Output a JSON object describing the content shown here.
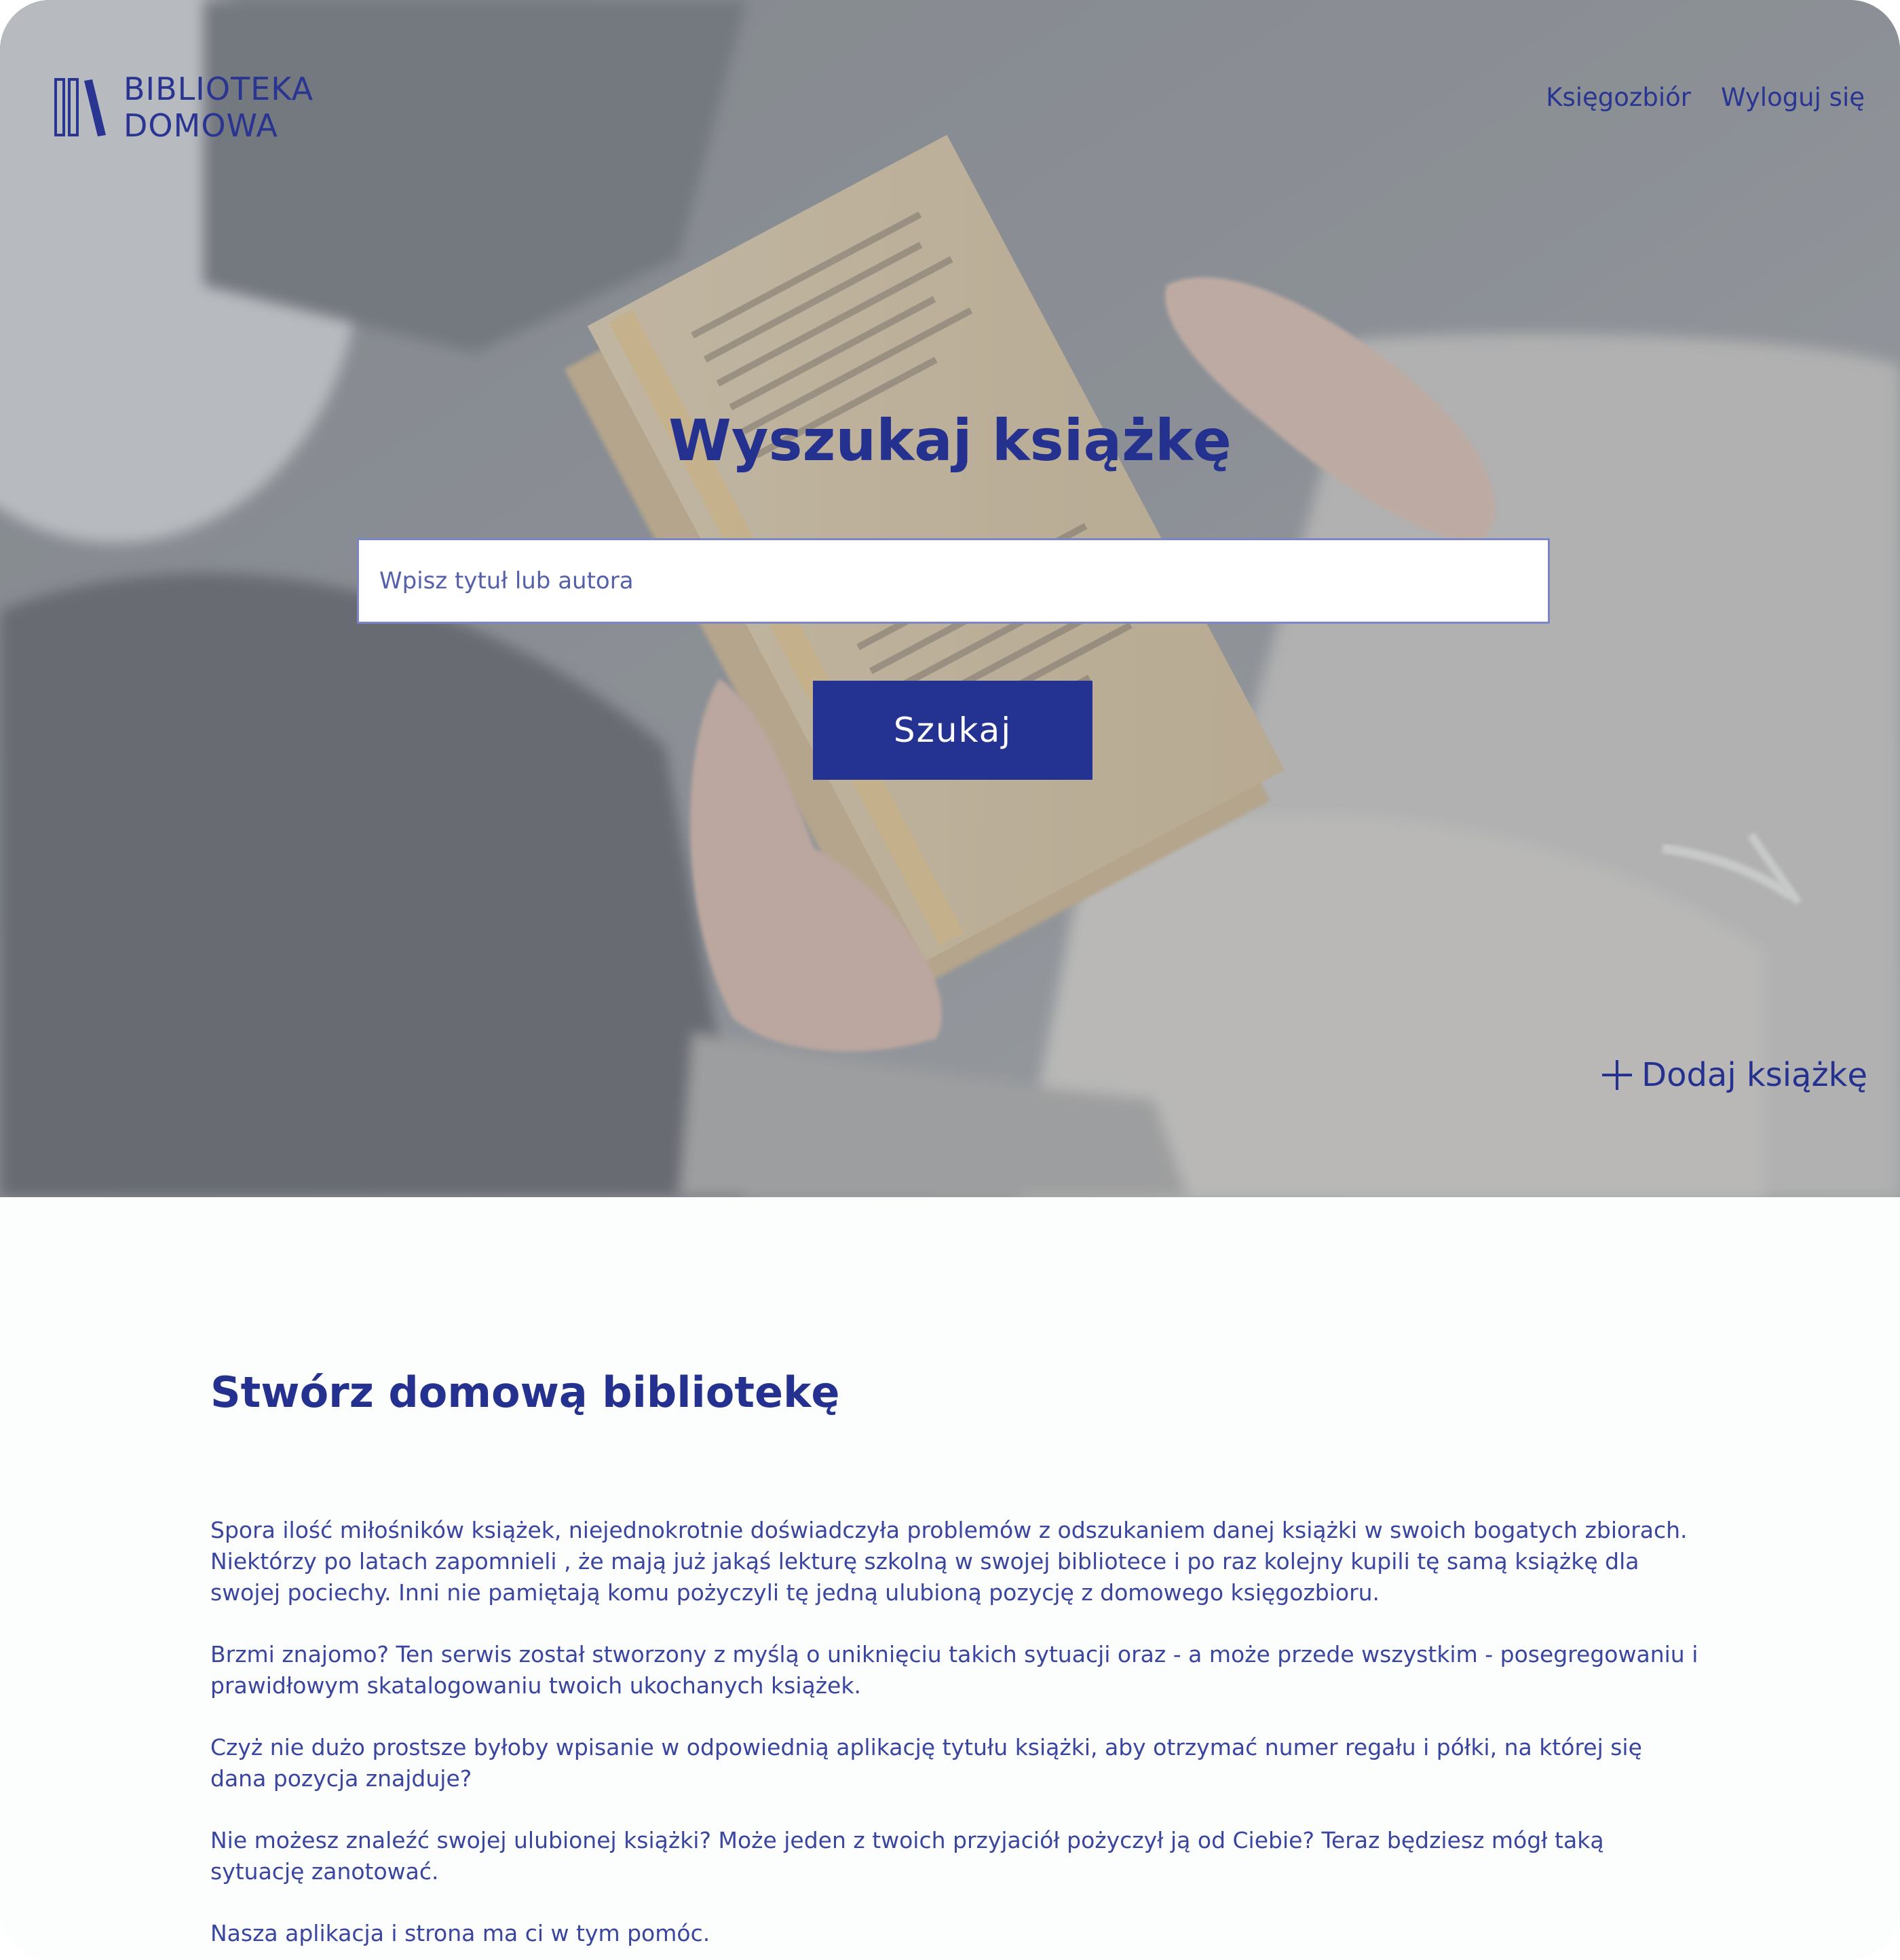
{
  "header": {
    "logo_line1": "BIBLIOTEKA",
    "logo_line2": "DOMOWA",
    "nav": [
      {
        "label": "Księgozbiór"
      },
      {
        "label": "Wyloguj się"
      }
    ]
  },
  "hero": {
    "title": "Wyszukaj książkę",
    "search_placeholder": "Wpisz tytuł lub autora",
    "search_button": "Szukaj",
    "add_book": "Dodaj książkę"
  },
  "about": {
    "title": "Stwórz domową bibliotekę",
    "paragraphs": [
      "Spora ilość miłośników książek, niejednokrotnie doświadczyła problemów z odszukaniem danej książki w swoich bogatych zbiorach. Niektórzy po latach zapomnieli , że mają już jakąś lekturę szkolną w swojej bibliotece i po raz kolejny kupili tę samą książkę dla swojej pociechy. Inni nie pamiętają komu pożyczyli tę jedną ulubioną pozycję z domowego księgozbioru.",
      "Brzmi znajomo? Ten serwis został stworzony z myślą o uniknięciu takich sytuacji oraz - a może przede wszystkim - posegregowaniu i prawidłowym skatalogowaniu twoich ukochanych książek.",
      "Czyż nie dużo prostsze byłoby wpisanie w odpowiednią aplikację tytułu książki, aby otrzymać numer regału i półki, na której się dana pozycja znajduje?",
      "Nie możesz znaleźć swojej ulubionej książki? Może jeden z twoich przyjaciół pożyczył ją od Ciebie? Teraz będziesz mógł taką sytuację zanotować.",
      "Nasza aplikacja i strona ma ci w tym pomóc."
    ]
  },
  "colors": {
    "brand": "#25318f",
    "button_bg": "#243292",
    "hero_overlay": "#a0a5ac"
  },
  "icons": {
    "logo": "library-books-logo-icon",
    "add": "plus-icon"
  }
}
